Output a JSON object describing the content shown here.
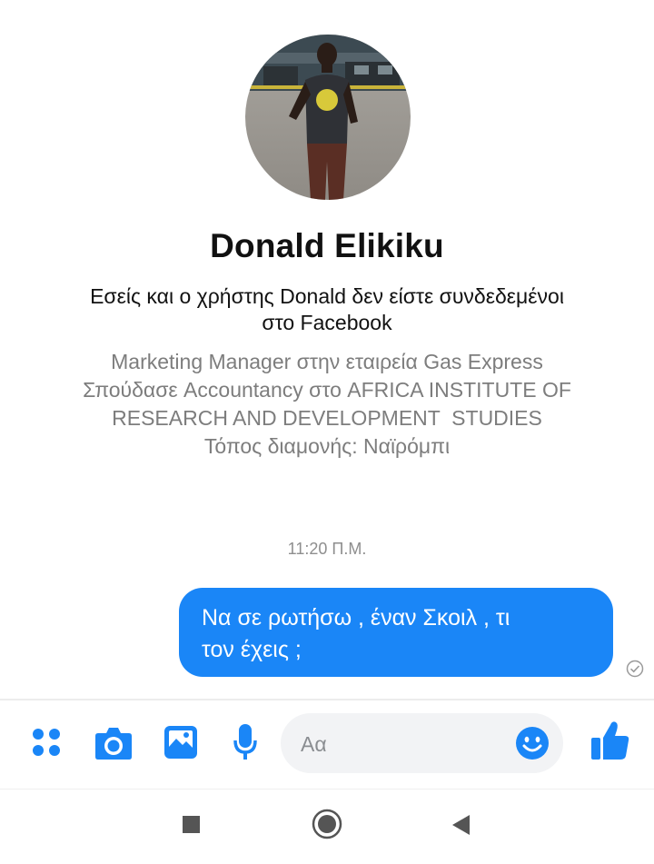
{
  "profile": {
    "name": "Donald Elikiku",
    "connection_notice_line1": "Εσείς και ο χρήστης Donald δεν είστε συνδεδεμένοι",
    "connection_notice_line2": "στο Facebook",
    "info_lines": [
      "Marketing Manager στην εταιρεία Gas Express",
      "Σπούδασε Accountancy στο AFRICA INSTITUTE OF",
      "RESEARCH AND DEVELOPMENT  STUDIES",
      "Τόπος διαμονής: Ναϊρόμπι"
    ]
  },
  "conversation": {
    "timestamp": "11:20 Π.Μ.",
    "messages": [
      {
        "sender": "self",
        "line1": "Να σε ρωτήσω , έναν Σκοιλ , τι",
        "line2": "τον έχεις ;",
        "status": "sent"
      }
    ]
  },
  "composer": {
    "placeholder": "Αα",
    "icons": [
      "more-apps-icon",
      "camera-icon",
      "gallery-icon",
      "microphone-icon",
      "emoji-icon",
      "like-icon"
    ]
  },
  "colors": {
    "accent": "#1a86f7",
    "bubble_text": "#ffffff",
    "secondary_text": "#7d7d7d"
  }
}
